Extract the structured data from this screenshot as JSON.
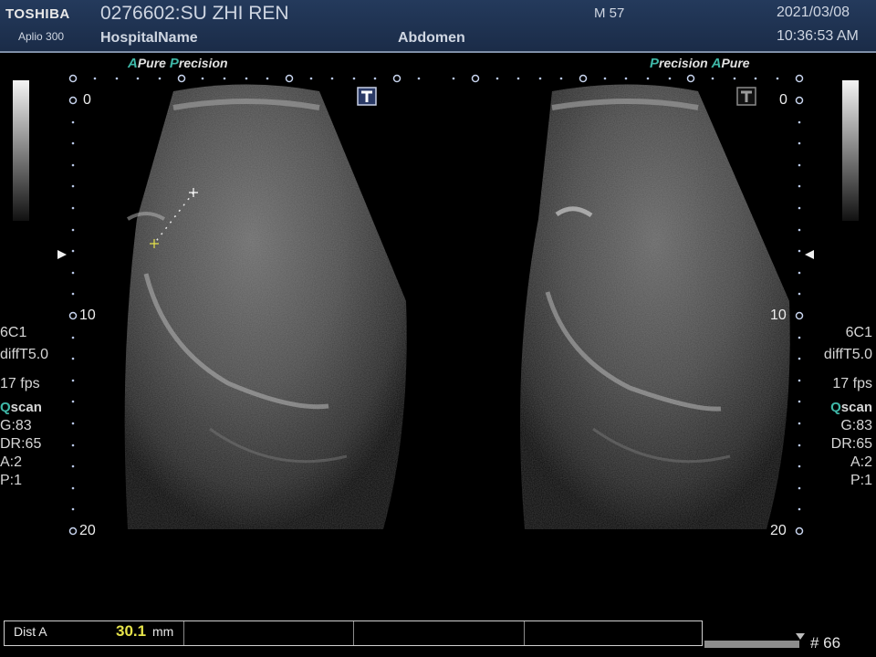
{
  "header": {
    "brand": "TOSHIBA",
    "model": "Aplio 300",
    "patient": "0276602:SU ZHI REN",
    "hospital": "HospitalName",
    "sex_age": "M 57",
    "exam": "Abdomen",
    "date": "2021/03/08",
    "time": "10:36:53 AM"
  },
  "left_image": {
    "tag_part1_accent": "A",
    "tag_part1": "Pure",
    "tag_part2_accent": "P",
    "tag_part2": "recision",
    "depth_top": "0",
    "depth_mid": "10",
    "depth_bottom": "20",
    "params": {
      "probe": "6C1",
      "mode": "diffT5.0",
      "fps": "17 fps",
      "q_prefix": "Q",
      "q_rest": "scan",
      "gain": "G:83",
      "dr": "DR:65",
      "a": "A:2",
      "p": "P:1"
    }
  },
  "right_image": {
    "tag_part1_accent": "P",
    "tag_part1": "recision",
    "tag_part2_accent": "A",
    "tag_part2": "Pure",
    "depth_top": "0",
    "depth_mid": "10",
    "depth_bottom": "20",
    "params": {
      "probe": "6C1",
      "mode": "diffT5.0",
      "fps": "17 fps",
      "q_prefix": "Q",
      "q_rest": "scan",
      "gain": "G:83",
      "dr": "DR:65",
      "a": "A:2",
      "p": "P:1"
    }
  },
  "measurement": {
    "label": "Dist A",
    "value": "30.1",
    "unit": "mm"
  },
  "frame": {
    "number": "# 66"
  },
  "icons": [
    "t-marker-icon",
    "focus-marker-icon",
    "caliper-icon",
    "grayscale-bar-icon"
  ],
  "colors": {
    "header_bg": "#1f3352",
    "accent_teal": "#3fb8a8",
    "caliper_yellow": "#e6e34a",
    "text_light": "#d8d8d8"
  }
}
